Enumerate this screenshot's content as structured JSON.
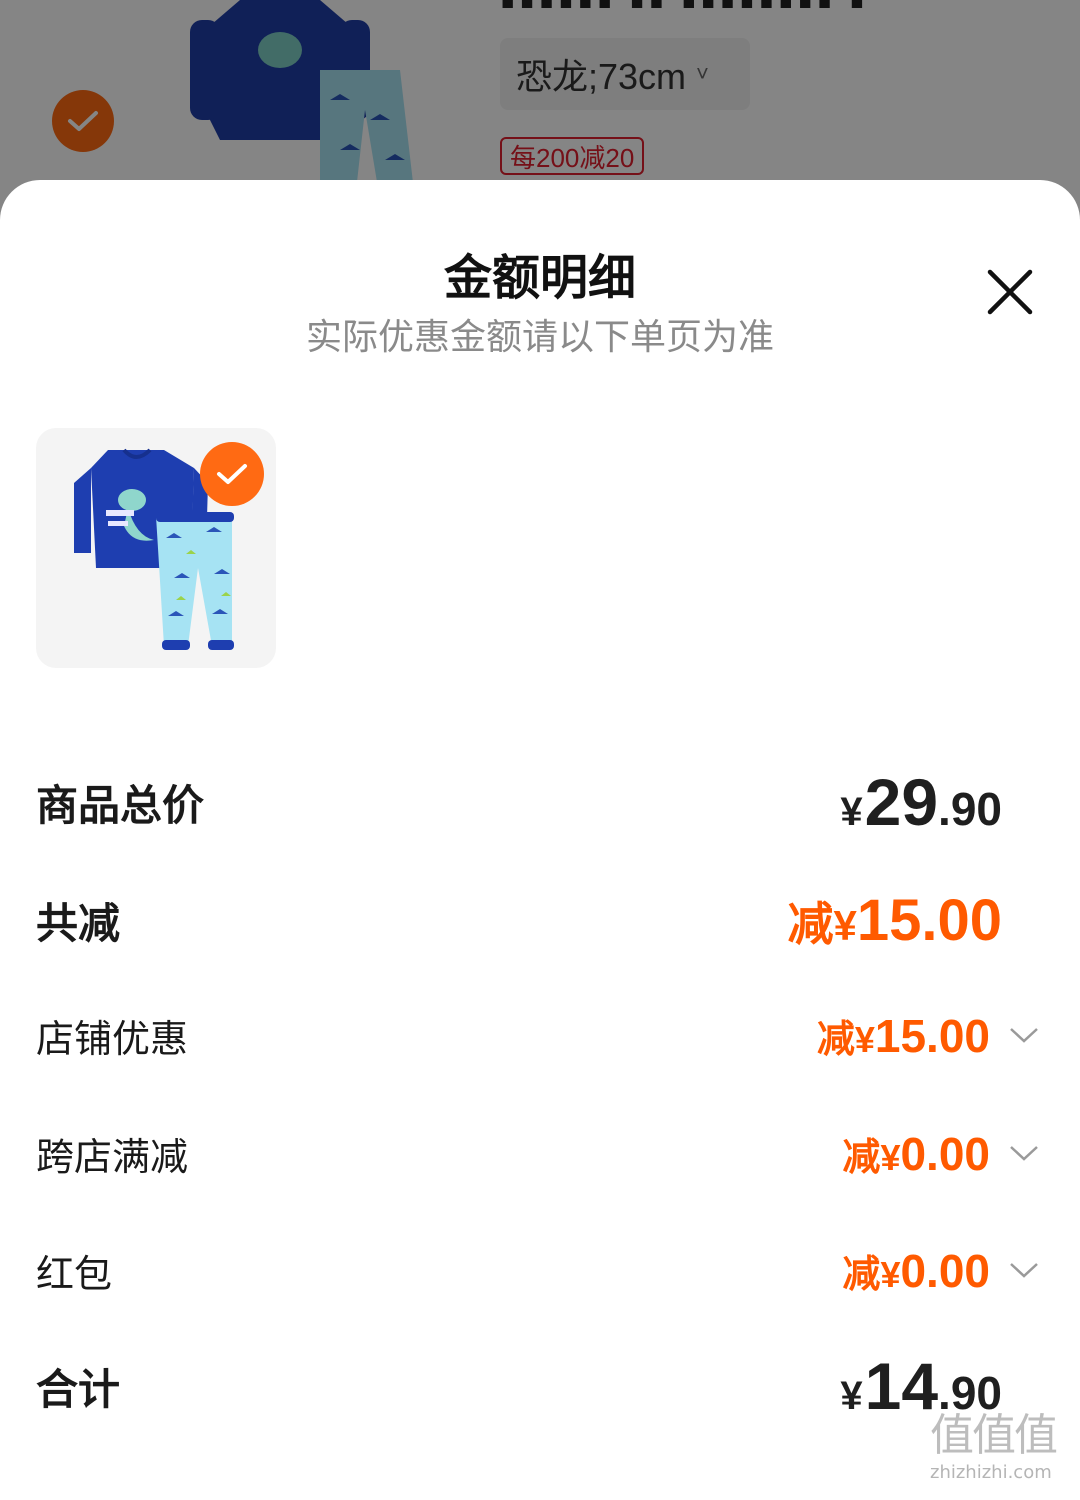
{
  "background": {
    "spec_value": "恐龙;73cm",
    "promo_badge": "每200减20"
  },
  "sheet": {
    "title": "金额明细",
    "subtitle": "实际优惠金额请以下单页为准",
    "close_icon": "close-icon",
    "product_selected": true
  },
  "rows": {
    "subtotal": {
      "label": "商品总价",
      "currency": "¥",
      "int": "29",
      "dec": ".90"
    },
    "total_discount": {
      "label": "共减",
      "prefix": "减",
      "currency": "¥",
      "value": "15.00"
    },
    "store_discount": {
      "label": "店铺优惠",
      "prefix": "减",
      "currency": "¥",
      "value": "15.00"
    },
    "cross_store": {
      "label": "跨店满减",
      "prefix": "减",
      "currency": "¥",
      "value": "0.00"
    },
    "red_packet": {
      "label": "红包",
      "prefix": "减",
      "currency": "¥",
      "value": "0.00"
    },
    "total": {
      "label": "合计",
      "currency": "¥",
      "int": "14",
      "dec": ".90"
    }
  },
  "watermark": {
    "logo": "值值值",
    "url": "zhizhizhi.com"
  },
  "colors": {
    "accent_orange": "#ff5a00",
    "check_orange": "#ff6a13",
    "badge_red": "#e0202e"
  }
}
